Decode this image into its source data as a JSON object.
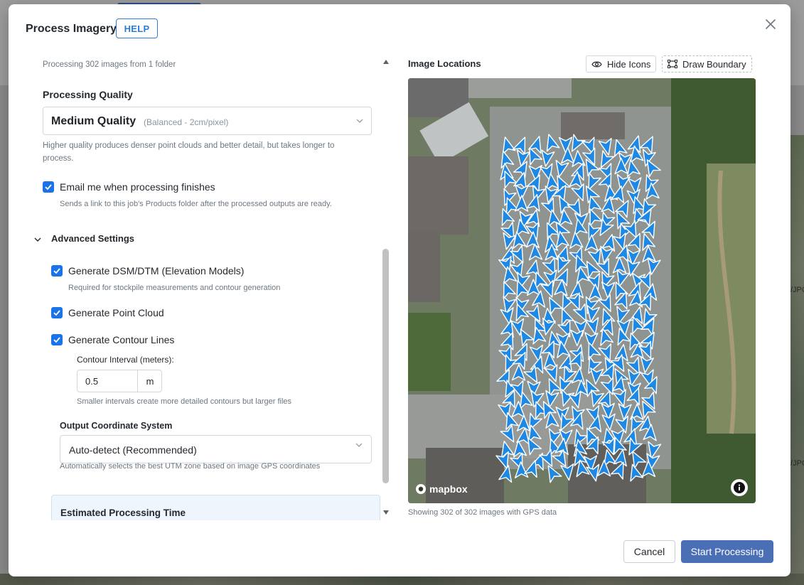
{
  "dialog": {
    "title": "Process Imagery",
    "help_label": "HELP"
  },
  "left": {
    "subtitle": "Processing 302 images from 1 folder",
    "quality": {
      "label": "Processing Quality",
      "selected": "Medium Quality",
      "selected_note": "(Balanced - 2cm/pixel)",
      "help_line1": "Higher quality produces denser point clouds and better detail, but takes longer to",
      "help_line2": "process."
    },
    "email": {
      "label": "Email me when processing finishes",
      "checked": true,
      "help": "Sends a link to this job's Products folder after the processed outputs are ready."
    },
    "advanced": {
      "label": "Advanced Settings",
      "dsm": {
        "label": "Generate DSM/DTM (Elevation Models)",
        "checked": true,
        "help": "Required for stockpile measurements and contour generation"
      },
      "point_cloud": {
        "label": "Generate Point Cloud",
        "checked": true
      },
      "contours": {
        "label": "Generate Contour Lines",
        "checked": true
      },
      "interval": {
        "label": "Contour Interval (meters):",
        "value": "0.5",
        "unit": "m",
        "help": "Smaller intervals create more detailed contours but larger files"
      },
      "coordinate": {
        "label": "Output Coordinate System",
        "selected": "Auto-detect (Recommended)",
        "help": "Automatically selects the best UTM zone based on image GPS coordinates"
      }
    },
    "estimate": {
      "title": "Estimated Processing Time"
    }
  },
  "map": {
    "title": "Image Locations",
    "hide_icons_label": "Hide Icons",
    "draw_boundary_label": "Draw Boundary",
    "caption": "Showing 302 of 302 images with GPS data",
    "attribution": "mapbox",
    "marker_color": "#1e88e5"
  },
  "footer": {
    "cancel_label": "Cancel",
    "start_label": "Start Processing",
    "start_color": "#4a6fb5"
  },
  "backdrop": {
    "right_labels": [
      "/JPG",
      "/JPG"
    ]
  }
}
